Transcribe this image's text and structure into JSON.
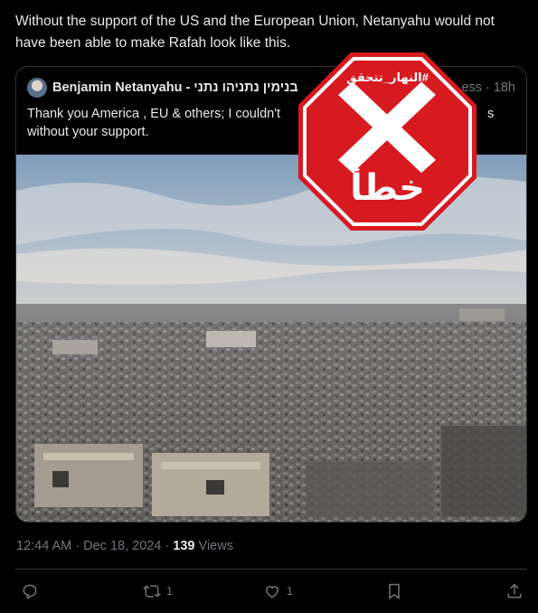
{
  "post": {
    "text": "Without the support of the US and the European Union, Netanyahu would not have been able to make Rafah look like this."
  },
  "quoted": {
    "name": "Benjamin Netanyahu -",
    "name_hebrew": "בנימין נתניהו נתני",
    "handle": "ess",
    "separator": "·",
    "time": "18h",
    "text": "Thank you America , EU & others; I couldn't ",
    "text_after": "s without your support.",
    "text_line2": "without your support."
  },
  "stamp": {
    "hashtag": "#النهار_تتحقق",
    "verdict": "خطأ",
    "mark": "X",
    "color": "#d71920"
  },
  "meta": {
    "timestamp": "12:44 AM · Dec 18, 2024 · ",
    "views_count": "139",
    "views_label": " Views"
  },
  "actions": {
    "reply_icon": "reply-icon",
    "repost_icon": "repost-icon",
    "repost_count": "1",
    "like_icon": "like-icon",
    "like_count": "1",
    "bookmark_icon": "bookmark-icon",
    "share_icon": "share-icon"
  },
  "colors": {
    "background": "#000000",
    "text": "#e7e9ea",
    "secondary": "#71767b",
    "border": "#2f3336"
  }
}
